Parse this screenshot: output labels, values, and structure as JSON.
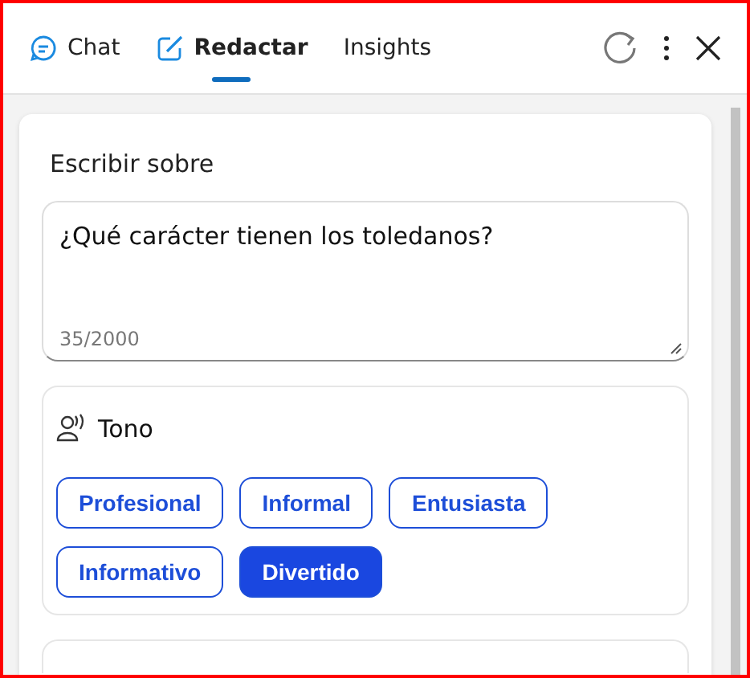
{
  "tabs": [
    {
      "label": "Chat",
      "kind": "chat",
      "selected": false
    },
    {
      "label": "Redactar",
      "kind": "compose",
      "selected": true
    },
    {
      "label": "Insights",
      "kind": "plain",
      "selected": false
    }
  ],
  "compose": {
    "label": "Escribir sobre",
    "value": "¿Qué carácter tienen los toledanos?",
    "counter": "35/2000"
  },
  "tone": {
    "title": "Tono",
    "options": [
      {
        "label": "Profesional",
        "selected": false
      },
      {
        "label": "Informal",
        "selected": false
      },
      {
        "label": "Entusiasta",
        "selected": false
      },
      {
        "label": "Informativo",
        "selected": false
      },
      {
        "label": "Divertido",
        "selected": true
      }
    ]
  }
}
